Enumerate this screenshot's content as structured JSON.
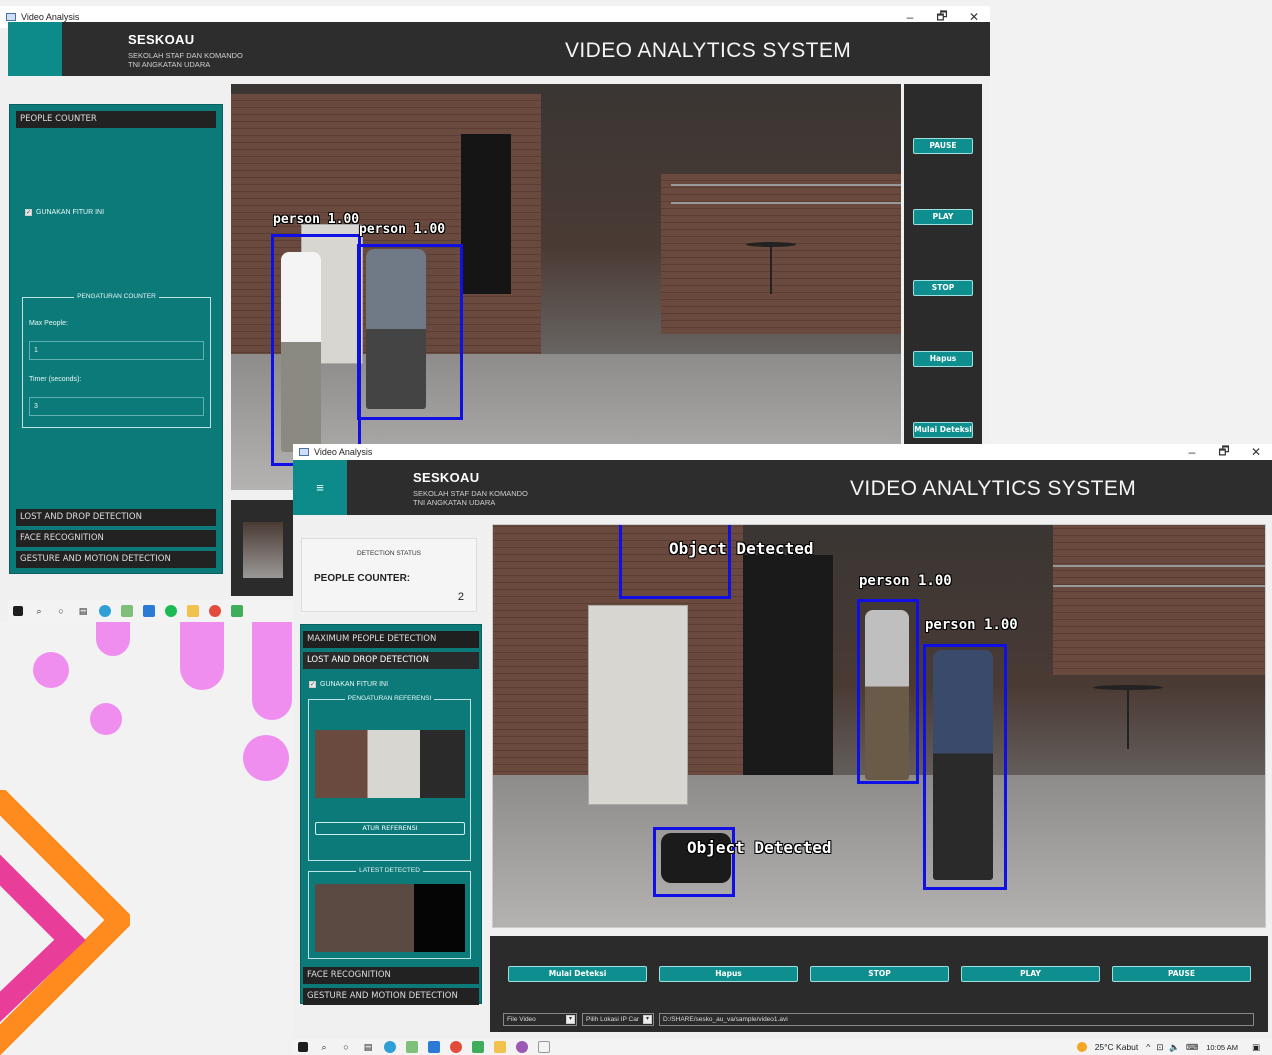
{
  "colors": {
    "teal": "#0d7a7a",
    "accent_teal": "#0e8e8e",
    "header": "#2d2d2d",
    "detection_box": "#1010e6"
  },
  "window_back": {
    "title": "Video Analysis",
    "brand_title": "SESKOAU",
    "brand_sub1": "SEKOLAH STAF DAN KOMANDO",
    "brand_sub2": "TNI ANGKATAN UDARA",
    "header_title": "VIDEO ANALYTICS SYSTEM",
    "panel": {
      "section_people": "PEOPLE COUNTER",
      "checkbox": "GUNAKAN FITUR INI",
      "group_title": "PENGATURAN COUNTER",
      "max_label": "Max People:",
      "max_value": "1",
      "timer_label": "Timer (seconds):",
      "timer_value": "3",
      "section_lost": "LOST AND DROP DETECTION",
      "section_face": "FACE RECOGNITION",
      "section_gesture": "GESTURE AND MOTION DETECTION"
    },
    "detections": [
      "person 1.00",
      "person 1.00"
    ],
    "buttons": {
      "pause": "PAUSE",
      "play": "PLAY",
      "stop": "STOP",
      "hapus": "Hapus",
      "mulai": "Mulai Deteksi"
    }
  },
  "window_front": {
    "title": "Video Analysis",
    "brand_title": "SESKOAU",
    "brand_sub1": "SEKOLAH STAF DAN KOMANDO",
    "brand_sub2": "TNI ANGKATAN UDARA",
    "header_title": "VIDEO ANALYTICS SYSTEM",
    "menu_icon": "≡",
    "status": {
      "title": "DETECTION STATUS",
      "label": "PEOPLE COUNTER:",
      "value": "2"
    },
    "panel": {
      "section_max": "MAXIMUM PEOPLE DETECTION",
      "section_lost": "LOST AND DROP DETECTION",
      "checkbox": "GUNAKAN FITUR INI",
      "group_ref": "PENGATURAN REFERENSI",
      "set_ref_button": "ATUR REFERENSI",
      "group_latest": "LATEST DETECTED",
      "section_face": "FACE RECOGNITION",
      "section_gesture": "GESTURE AND MOTION DETECTION"
    },
    "detections": {
      "object_top": "Object Detected",
      "object_bottom": "Object Detected",
      "person_a": "person 1.00",
      "person_b": "person 1.00"
    },
    "buttons": {
      "mulai": "Mulai Deteksi",
      "hapus": "Hapus",
      "stop": "STOP",
      "play": "PLAY",
      "pause": "PAUSE"
    },
    "source_combo": "File Video",
    "ip_combo": "Pilih Lokasi IP Car",
    "path": "D:/SHARE/sesko_au_va/sample/video1.avi"
  },
  "taskbar": {
    "weather": "25°C  Kabut",
    "time": "10:05 AM",
    "icons": [
      "windows-icon",
      "search-icon",
      "cortana-icon",
      "task-view-icon",
      "edge-icon",
      "notepad-icon",
      "vscode-icon",
      "spotify-icon",
      "chrome-icon",
      "folder-icon"
    ]
  },
  "window_controls": {
    "minimize": "–",
    "maximize": "🗗",
    "close": "✕"
  }
}
